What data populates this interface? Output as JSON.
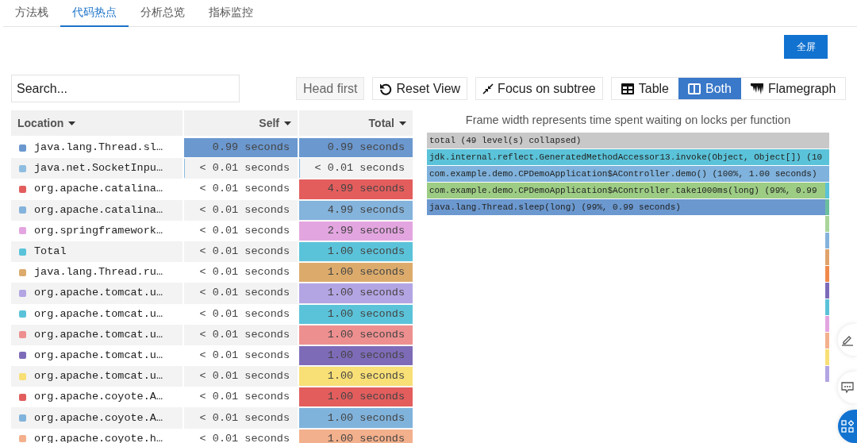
{
  "tabs": [
    {
      "label": "方法栈",
      "selected": false
    },
    {
      "label": "代码热点",
      "selected": true
    },
    {
      "label": "分析总览",
      "selected": false
    },
    {
      "label": "指标监控",
      "selected": false
    }
  ],
  "fullscreen_button": "全屏",
  "toolbar": {
    "search": {
      "placeholder": "Search..."
    },
    "order_button": "Head first",
    "reset_button": "Reset View",
    "focus_button": "Focus on subtree",
    "view_modes": [
      {
        "kind": "table",
        "label": "Table",
        "selected": false
      },
      {
        "kind": "both",
        "label": "Both",
        "selected": true
      },
      {
        "kind": "flamegraph",
        "label": "Flamegraph",
        "selected": false
      }
    ]
  },
  "table": {
    "columns": [
      "Location",
      "Self",
      "Total"
    ],
    "rows": [
      {
        "location": "java.lang.Thread.sl…",
        "color": "#6b98cf",
        "self": {
          "text": "0.99 seconds",
          "level": 1
        },
        "total": {
          "text": "0.99 seconds",
          "level": 1
        }
      },
      {
        "location": "java.net.SocketInpu…",
        "color": "#8fbde0",
        "self": {
          "text": "< 0.01 seconds",
          "level": 0.005
        },
        "total": {
          "text": "< 0.01 seconds",
          "level": 0.005
        }
      },
      {
        "location": "org.apache.catalina…",
        "color": "#e35d5d",
        "self": {
          "text": "< 0.01 seconds"
        },
        "total": {
          "text": "4.99 seconds",
          "level": 1
        }
      },
      {
        "location": "org.apache.catalina…",
        "color": "#84b3dc",
        "self": {
          "text": "< 0.01 seconds"
        },
        "total": {
          "text": "4.99 seconds",
          "level": 1
        }
      },
      {
        "location": "org.springframework…",
        "color": "#e3a5e0",
        "self": {
          "text": "< 0.01 seconds"
        },
        "total": {
          "text": "2.99 seconds",
          "level": 1
        }
      },
      {
        "location": "Total",
        "color": "#5bc3d9",
        "self": {
          "text": "< 0.01 seconds"
        },
        "total": {
          "text": "1.00 seconds",
          "level": 1
        }
      },
      {
        "location": "java.lang.Thread.ru…",
        "color": "#dcab6c",
        "self": {
          "text": "< 0.01 seconds"
        },
        "total": {
          "text": "1.00 seconds",
          "level": 1
        }
      },
      {
        "location": "org.apache.tomcat.u…",
        "color": "#b3a5e3",
        "self": {
          "text": "< 0.01 seconds"
        },
        "total": {
          "text": "1.00 seconds",
          "level": 1
        }
      },
      {
        "location": "org.apache.tomcat.u…",
        "color": "#5bc3d9",
        "self": {
          "text": "< 0.01 seconds"
        },
        "total": {
          "text": "1.00 seconds",
          "level": 1
        }
      },
      {
        "location": "org.apache.tomcat.u…",
        "color": "#ee8f8f",
        "self": {
          "text": "< 0.01 seconds"
        },
        "total": {
          "text": "1.00 seconds",
          "level": 1
        }
      },
      {
        "location": "org.apache.tomcat.u…",
        "color": "#7e6bb8",
        "self": {
          "text": "< 0.01 seconds"
        },
        "total": {
          "text": "1.00 seconds",
          "level": 1
        }
      },
      {
        "location": "org.apache.tomcat.u…",
        "color": "#f8df76",
        "self": {
          "text": "< 0.01 seconds"
        },
        "total": {
          "text": "1.00 seconds",
          "level": 1
        }
      },
      {
        "location": "org.apache.coyote.A…",
        "color": "#e35d5d",
        "self": {
          "text": "< 0.01 seconds"
        },
        "total": {
          "text": "1.00 seconds",
          "level": 1
        }
      },
      {
        "location": "org.apache.coyote.A…",
        "color": "#80b3dc",
        "self": {
          "text": "< 0.01 seconds"
        },
        "total": {
          "text": "1.00 seconds",
          "level": 1
        }
      },
      {
        "location": "org.apache.coyote.h…",
        "color": "#f3b08c",
        "self": {
          "text": "< 0.01 seconds"
        },
        "total": {
          "text": "1.00 seconds",
          "level": 1
        }
      }
    ]
  },
  "flamegraph": {
    "title": "Frame width represents time spent waiting on locks per function",
    "frames": [
      {
        "label": "total (49 level(s) collapsed)",
        "color": "#c8c8c8"
      },
      {
        "label": "jdk.internal.reflect.GeneratedMethodAccessor13.invoke(Object, Object[]) (10",
        "color": "#5bc3d9"
      },
      {
        "label": "com.example.demo.CPDemoApplication$AController.demo() (100%, 1.00 seconds)",
        "color": "#7fb2dc"
      },
      {
        "label": "com.example.demo.CPDemoApplication$AController.take1000ms(long) (99%, 0.99",
        "color": "#9dcc84"
      },
      {
        "label": "java.lang.Thread.sleep(long) (99%, 0.99 seconds)",
        "color": "#6b98cf"
      }
    ]
  }
}
